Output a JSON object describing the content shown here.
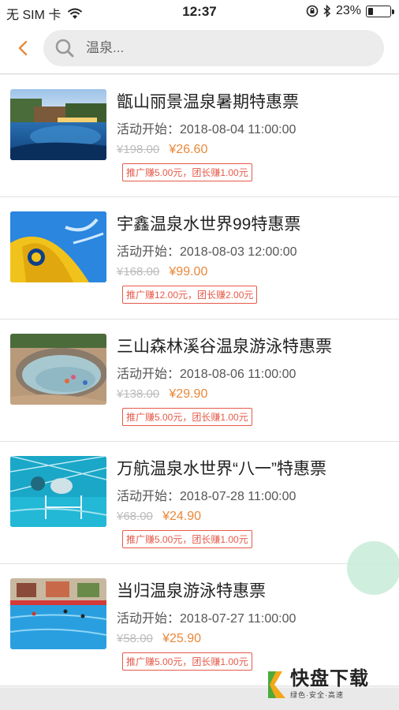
{
  "status": {
    "carrier": "无 SIM 卡",
    "time": "12:37",
    "battery": "23%",
    "battery_level": 0.23
  },
  "search": {
    "placeholder": "温泉..."
  },
  "items": [
    {
      "title": "甑山丽景温泉暑期特惠票",
      "start": "活动开始：2018-08-04 11:00:00",
      "old_price": "¥198.00",
      "new_price": "¥26.60",
      "promo": "推广赚5.00元，团长赚1.00元"
    },
    {
      "title": "宇鑫温泉水世界99特惠票",
      "start": "活动开始：2018-08-03 12:00:00",
      "old_price": "¥168.00",
      "new_price": "¥99.00",
      "promo": "推广赚12.00元，团长赚2.00元"
    },
    {
      "title": "三山森林溪谷温泉游泳特惠票",
      "start": "活动开始：2018-08-06 11:00:00",
      "old_price": "¥138.00",
      "new_price": "¥29.90",
      "promo": "推广赚5.00元，团长赚1.00元"
    },
    {
      "title": "万航温泉水世界“八一”特惠票",
      "start": "活动开始：2018-07-28 11:00:00",
      "old_price": "¥68.00",
      "new_price": "¥24.90",
      "promo": "推广赚5.00元，团长赚1.00元"
    },
    {
      "title": "当归温泉游泳特惠票",
      "start": "活动开始：2018-07-27 11:00:00",
      "old_price": "¥58.00",
      "new_price": "¥25.90",
      "promo": "推广赚5.00元，团长赚1.00元"
    }
  ],
  "watermark": {
    "title": "快盘下载",
    "subtitle": "绿色·安全·高速"
  },
  "colors": {
    "accent": "#e8883a",
    "promo": "#e65a4a"
  }
}
